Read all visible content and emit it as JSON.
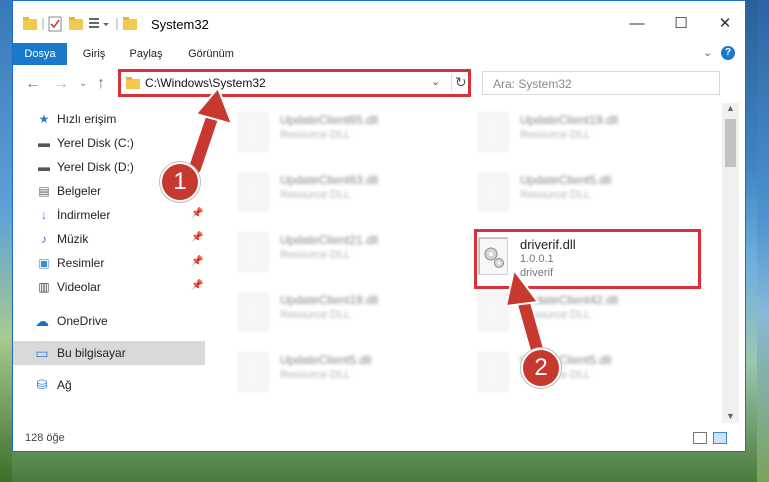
{
  "window": {
    "title": "System32",
    "controls": {
      "minimize": "—",
      "maximize": "☐",
      "close": "✕"
    }
  },
  "ribbon": {
    "tabs": [
      {
        "label": "Dosya"
      },
      {
        "label": "Giriş"
      },
      {
        "label": "Paylaş"
      },
      {
        "label": "Görünüm"
      }
    ],
    "help": "?"
  },
  "nav": {
    "address": "C:\\Windows\\System32",
    "search_placeholder": "Ara: System32"
  },
  "sidebar": {
    "items": [
      {
        "label": "Hızlı erişim",
        "icon": "★"
      },
      {
        "label": "Yerel Disk (C:)",
        "icon": "▬"
      },
      {
        "label": "Yerel Disk (D:)",
        "icon": "▬"
      },
      {
        "label": "Belgeler",
        "icon": "▤"
      },
      {
        "label": "İndirmeler",
        "icon": "↓"
      },
      {
        "label": "Müzik",
        "icon": "♪"
      },
      {
        "label": "Resimler",
        "icon": "▣"
      },
      {
        "label": "Videolar",
        "icon": "▥"
      },
      {
        "label": "OneDrive",
        "icon": "☁"
      },
      {
        "label": "Bu bilgisayar",
        "icon": "▭"
      },
      {
        "label": "Ağ",
        "icon": "⛁"
      }
    ]
  },
  "files": {
    "left": [
      {
        "name": "UpdateClient65.dll",
        "desc": "Resource DLL"
      },
      {
        "name": "UpdateClient63.dll",
        "desc": "Resource DLL"
      },
      {
        "name": "UpdateClient21.dll",
        "desc": "Resource DLL"
      },
      {
        "name": "UpdateClient19.dll",
        "desc": "Resource DLL"
      },
      {
        "name": "UpdateClient5.dll",
        "desc": "Resource DLL"
      }
    ],
    "right": [
      {
        "name": "UpdateClient19.dll",
        "desc": "Resource DLL"
      },
      {
        "name": "UpdateClient5.dll",
        "desc": "Resource DLL"
      },
      {
        "name": "UpdateClient42.dll",
        "desc": "Resource DLL"
      },
      {
        "name": "UpdateClient5.dll",
        "desc": "Resource DLL"
      }
    ],
    "highlighted": {
      "name": "driverif.dll",
      "version": "1.0.0.1",
      "desc": "driverif"
    }
  },
  "status": {
    "count": "128 öğe"
  },
  "annotations": {
    "step1": "1",
    "step2": "2",
    "color": "#c7382f"
  }
}
